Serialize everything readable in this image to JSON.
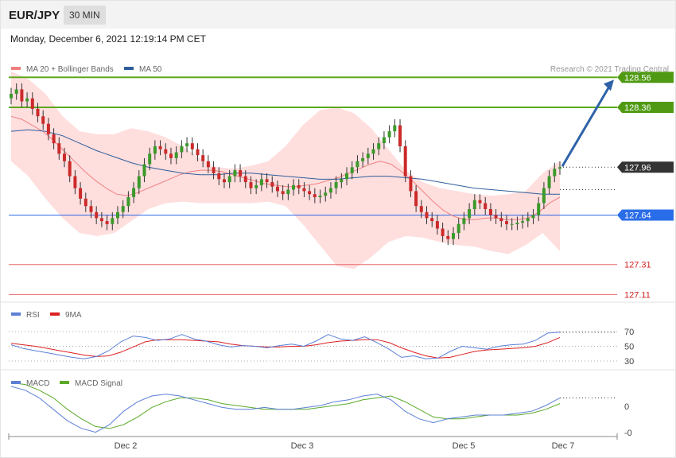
{
  "header": {
    "symbol": "EUR/JPY",
    "timeframe": "30 MIN",
    "datetime": "Monday, December 6, 2021 12:19:14 PM CET"
  },
  "credit": "Research © 2021 Trading Central",
  "colors": {
    "ma20": "#f08080",
    "ma50": "#2e5e9c",
    "bollinger_fill": "#ffdede",
    "bull": "#3a9a2a",
    "bear": "#cc2a2a",
    "resistance": "#5aa81e",
    "pivot": "#2e6be6",
    "support": "#e86b6b",
    "current": "#333333",
    "rsi": "#5c7fd6",
    "rsi_ma": "#dd2020",
    "macd": "#5c7fd6",
    "macd_signal": "#5aaa28",
    "arrow": "#2e62a8"
  },
  "legend": {
    "main": [
      {
        "label": "MA 20 + Bollinger Bands",
        "color": "#f08080"
      },
      {
        "label": "MA 50",
        "color": "#2e5e9c"
      }
    ],
    "rsi": [
      {
        "label": "RSI",
        "color": "#5c7fd6"
      },
      {
        "label": "9MA",
        "color": "#dd2020"
      }
    ],
    "macd": [
      {
        "label": "MACD",
        "color": "#5c7fd6"
      },
      {
        "label": "MACD Signal",
        "color": "#5aaa28"
      }
    ]
  },
  "levels": [
    {
      "value": 128.56,
      "label": "128.56",
      "kind": "resistance"
    },
    {
      "value": 128.36,
      "label": "128.36",
      "kind": "resistance"
    },
    {
      "value": 127.96,
      "label": "127.96",
      "kind": "current"
    },
    {
      "value": 127.64,
      "label": "127.64",
      "kind": "pivot"
    },
    {
      "value": 127.31,
      "label": "127.31",
      "kind": "support"
    },
    {
      "value": 127.11,
      "label": "127.11",
      "kind": "support"
    }
  ],
  "rsi_ticks": [
    "70",
    "50",
    "30"
  ],
  "macd_ticks": [
    "0",
    "-0"
  ],
  "x_labels": [
    "Dec 2",
    "Dec 3",
    "Dec 5",
    "Dec 7"
  ],
  "chart_data": {
    "type": "candlestick",
    "instrument": "EUR/JPY",
    "interval": "30 MIN",
    "y_range": [
      127.08,
      128.62
    ],
    "current_price": 127.96,
    "target_arrow": {
      "from": 127.96,
      "to": 128.56
    },
    "ohlc_close": [
      128.45,
      128.48,
      128.4,
      128.42,
      128.35,
      128.3,
      128.25,
      128.18,
      128.12,
      128.05,
      128.0,
      127.9,
      127.82,
      127.75,
      127.7,
      127.66,
      127.62,
      127.6,
      127.58,
      127.62,
      127.66,
      127.7,
      127.76,
      127.82,
      127.9,
      127.98,
      128.05,
      128.1,
      128.08,
      128.05,
      128.02,
      128.06,
      128.1,
      128.12,
      128.08,
      128.04,
      128.0,
      127.96,
      127.92,
      127.88,
      127.86,
      127.9,
      127.94,
      127.9,
      127.86,
      127.82,
      127.84,
      127.88,
      127.86,
      127.83,
      127.8,
      127.78,
      127.81,
      127.84,
      127.82,
      127.8,
      127.78,
      127.76,
      127.77,
      127.79,
      127.82,
      127.86,
      127.88,
      127.92,
      127.96,
      128.0,
      128.02,
      128.05,
      128.08,
      128.12,
      128.16,
      128.2,
      128.24,
      128.1,
      127.9,
      127.8,
      127.7,
      127.66,
      127.62,
      127.6,
      127.55,
      127.5,
      127.48,
      127.52,
      127.58,
      127.62,
      127.68,
      127.74,
      127.72,
      127.68,
      127.64,
      127.62,
      127.6,
      127.58,
      127.58,
      127.59,
      127.6,
      127.62,
      127.64,
      127.72,
      127.82,
      127.9,
      127.95,
      127.96
    ],
    "ma20": [
      128.3,
      128.28,
      128.24,
      128.2,
      128.14,
      128.07,
      128.0,
      127.93,
      127.87,
      127.82,
      127.78,
      127.77,
      127.79,
      127.82,
      127.85,
      127.88,
      127.91,
      127.93,
      127.94,
      127.94,
      127.93,
      127.91,
      127.89,
      127.87,
      127.85,
      127.84,
      127.83,
      127.83,
      127.84,
      127.85,
      127.87,
      127.89,
      127.92,
      127.95,
      127.98,
      128.0,
      127.98,
      127.93,
      127.87,
      127.8,
      127.73,
      127.67,
      127.63,
      127.61,
      127.61,
      127.62,
      127.62,
      127.61,
      127.61,
      127.62,
      127.66,
      127.72,
      127.76
    ],
    "bb_upper": [
      128.6,
      128.55,
      128.45,
      128.3,
      128.2,
      128.18,
      128.18,
      128.22,
      128.2,
      128.16,
      128.1,
      128.02,
      127.96,
      127.95,
      127.97,
      128.0,
      128.1,
      128.24,
      128.34,
      128.36,
      128.32,
      128.22,
      128.08,
      127.94,
      127.86,
      127.82,
      127.8,
      127.78,
      127.77,
      127.78,
      127.8,
      127.92,
      128.0
    ],
    "bb_lower": [
      128.0,
      127.9,
      127.75,
      127.62,
      127.52,
      127.5,
      127.52,
      127.6,
      127.68,
      127.72,
      127.73,
      127.72,
      127.72,
      127.72,
      127.72,
      127.73,
      127.7,
      127.58,
      127.44,
      127.3,
      127.28,
      127.36,
      127.46,
      127.5,
      127.49,
      127.46,
      127.44,
      127.43,
      127.4,
      127.38,
      127.44,
      127.52,
      127.4
    ],
    "ma50": [
      128.2,
      128.21,
      128.2,
      128.17,
      128.12,
      128.07,
      128.03,
      127.99,
      127.96,
      127.94,
      127.92,
      127.91,
      127.91,
      127.92,
      127.92,
      127.91,
      127.9,
      127.89,
      127.88,
      127.88,
      127.89,
      127.9,
      127.9,
      127.89,
      127.88,
      127.86,
      127.84,
      127.82,
      127.81,
      127.8,
      127.79,
      127.78,
      127.78
    ],
    "rsi": [
      52,
      47,
      44,
      41,
      38,
      35,
      33,
      36,
      44,
      56,
      64,
      62,
      58,
      60,
      66,
      60,
      57,
      52,
      49,
      51,
      50,
      48,
      51,
      53,
      50,
      57,
      66,
      60,
      58,
      63,
      55,
      46,
      35,
      37,
      33,
      34,
      43,
      50,
      48,
      46,
      50,
      52,
      53,
      58,
      68,
      69
    ],
    "rsi_ma": [
      54,
      52,
      50,
      47,
      44,
      41,
      38,
      36,
      37,
      42,
      49,
      56,
      59,
      59,
      59,
      58,
      57,
      56,
      53,
      51,
      50,
      49,
      49,
      50,
      50,
      52,
      55,
      57,
      58,
      59,
      59,
      55,
      48,
      42,
      37,
      34,
      35,
      39,
      43,
      45,
      46,
      47,
      48,
      50,
      55,
      62
    ],
    "macd": [
      0.1,
      0.08,
      0.04,
      -0.02,
      -0.08,
      -0.12,
      -0.14,
      -0.1,
      -0.03,
      0.02,
      0.05,
      0.06,
      0.05,
      0.03,
      0.01,
      -0.01,
      -0.02,
      -0.02,
      -0.01,
      -0.02,
      -0.02,
      -0.01,
      0.0,
      0.02,
      0.03,
      0.05,
      0.06,
      0.03,
      -0.03,
      -0.07,
      -0.09,
      -0.07,
      -0.06,
      -0.05,
      -0.05,
      -0.05,
      -0.04,
      -0.03,
      0.0,
      0.04
    ],
    "macd_signal": [
      0.12,
      0.11,
      0.08,
      0.04,
      -0.02,
      -0.07,
      -0.11,
      -0.12,
      -0.1,
      -0.06,
      -0.01,
      0.02,
      0.04,
      0.04,
      0.03,
      0.01,
      0.0,
      -0.01,
      -0.02,
      -0.02,
      -0.02,
      -0.02,
      -0.01,
      0.0,
      0.01,
      0.03,
      0.04,
      0.05,
      0.02,
      -0.02,
      -0.06,
      -0.07,
      -0.07,
      -0.06,
      -0.05,
      -0.05,
      -0.05,
      -0.04,
      -0.02,
      0.01
    ]
  }
}
